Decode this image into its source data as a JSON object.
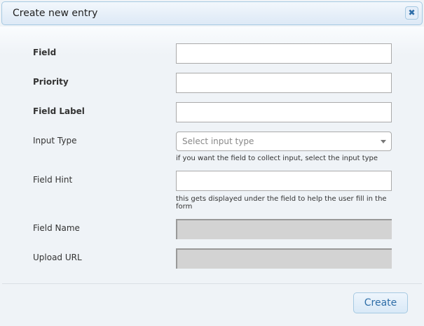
{
  "dialog": {
    "title": "Create new entry",
    "close_icon": "close-icon"
  },
  "fields": [
    {
      "label": "Field",
      "value": ""
    },
    {
      "label": "Priority",
      "value": ""
    },
    {
      "label": "Field Label",
      "value": ""
    },
    {
      "label": "Input Type",
      "placeholder": "Select input type",
      "hint": "if you want the field to collect input, select the input type"
    },
    {
      "label": "Field Hint",
      "value": "",
      "hint": "this gets displayed under the field to help the user fill in the form"
    },
    {
      "label": "Field Name",
      "value": ""
    },
    {
      "label": "Upload URL",
      "value": ""
    }
  ],
  "footer": {
    "create_label": "Create"
  }
}
